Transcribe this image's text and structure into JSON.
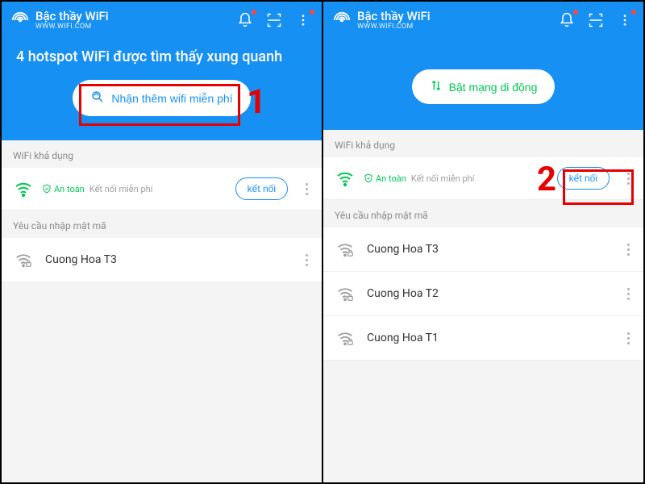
{
  "app": {
    "title": "Bậc thầy WiFi",
    "subtitle": "WWW.WIFI.COM"
  },
  "left": {
    "headline": "4 hotspot WiFi được tìm thấy xung quanh",
    "cta_label": "Nhận thêm wifi miễn phí",
    "section_available": "WiFi khả dụng",
    "safe_label": "An toàn",
    "free_label": "Kết nối miễn phí",
    "connect_label": "kết nối",
    "section_password": "Yêu cầu nhập mật mã",
    "networks": [
      {
        "name": "Cuong Hoa T3"
      }
    ]
  },
  "right": {
    "cta_label": "Bật mạng di động",
    "section_available": "WiFi khả dụng",
    "safe_label": "An toàn",
    "free_label": "Kết nối miễn phí",
    "connect_label": "kết nối",
    "section_password": "Yêu cầu nhập mật mã",
    "networks": [
      {
        "name": "Cuong Hoa T3"
      },
      {
        "name": "Cuong Hoa T2"
      },
      {
        "name": "Cuong Hoa T1"
      }
    ]
  },
  "annotations": {
    "one": "1",
    "two": "2"
  }
}
